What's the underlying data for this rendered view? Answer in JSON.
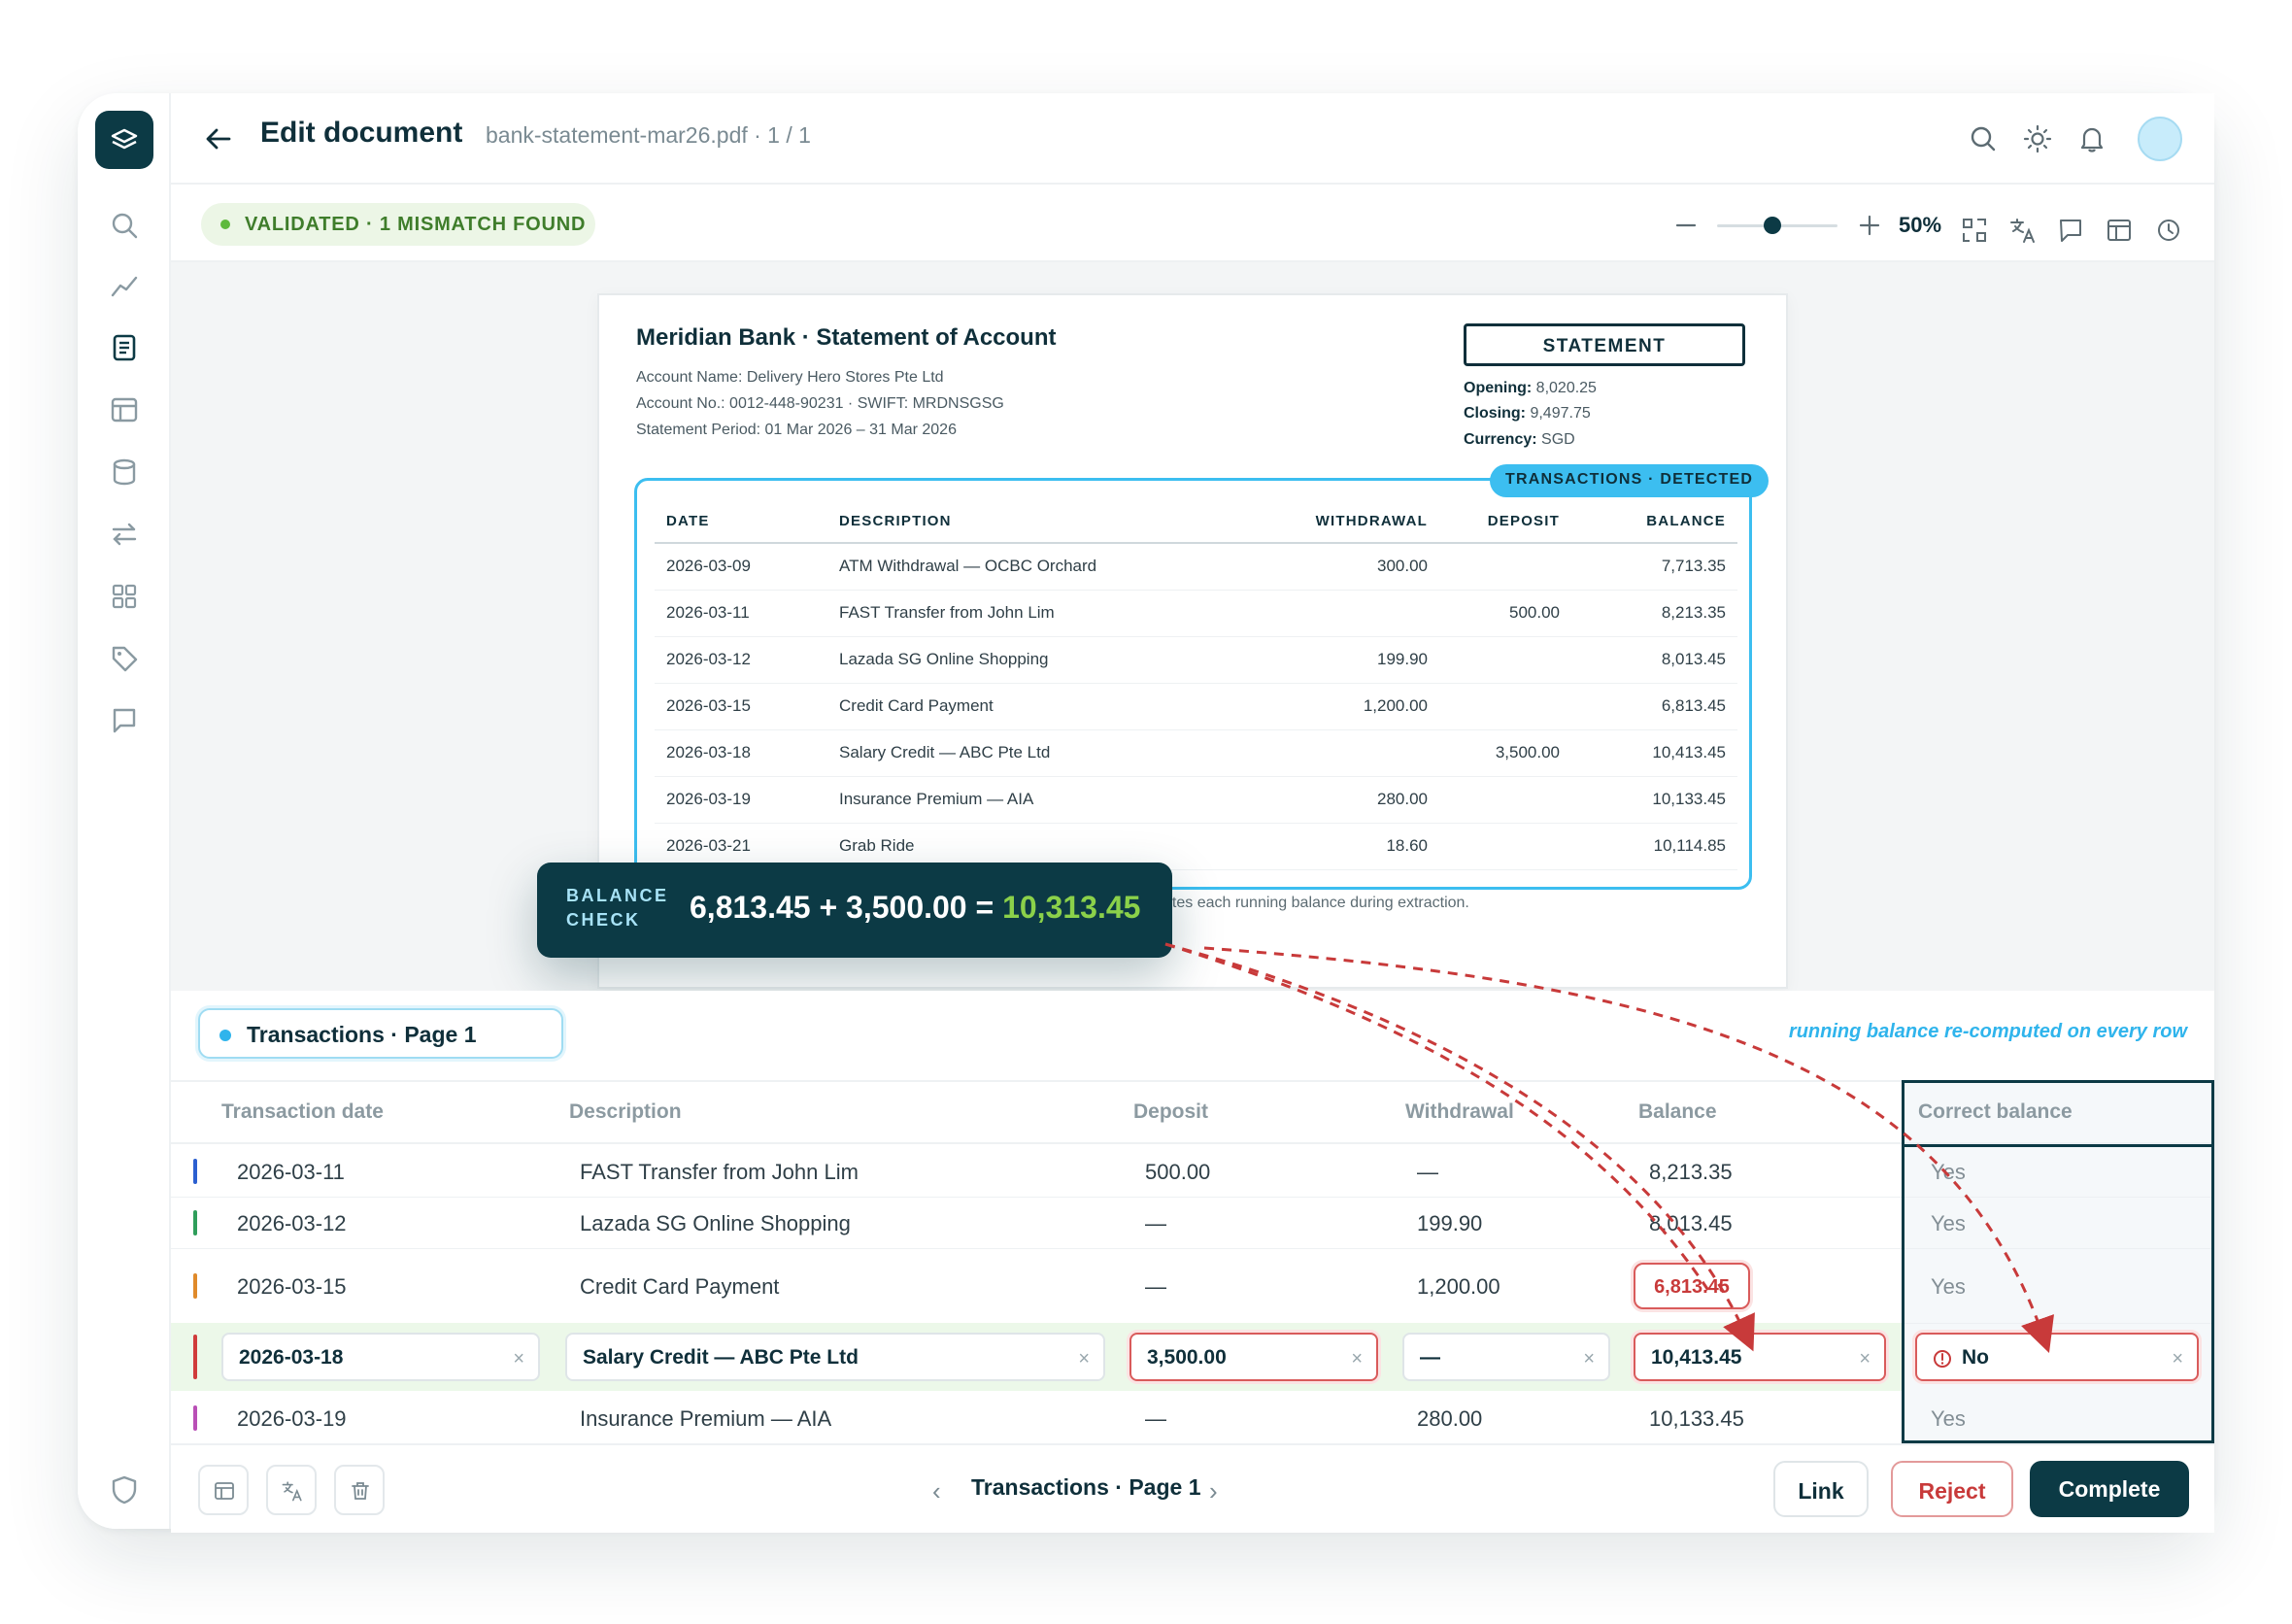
{
  "header": {
    "title": "Edit document",
    "file": "bank-statement-mar26.pdf · 1 / 1"
  },
  "status": {
    "badge": "VALIDATED · 1 MISMATCH FOUND",
    "zoom": "50%",
    "zoom_level": 0.5
  },
  "statement": {
    "title": "Meridian Bank · Statement of Account",
    "account_name": "Account Name: Delivery Hero Stores Pte Ltd",
    "account_no": "Account No.: 0012-448-90231  ·  SWIFT: MRDNSGSG",
    "period": "Statement Period: 01 Mar 2026 – 31 Mar 2026",
    "box_label": "STATEMENT",
    "opening_label": "Opening:",
    "opening": "8,020.25",
    "closing_label": "Closing:",
    "closing": "9,497.75",
    "currency_label": "Currency:",
    "currency": "SGD",
    "tag": "TRANSACTIONS · DETECTED",
    "columns": [
      "DATE",
      "DESCRIPTION",
      "WITHDRAWAL",
      "DEPOSIT",
      "BALANCE"
    ],
    "rows": [
      [
        "2026-03-09",
        "ATM Withdrawal — OCBC Orchard",
        "300.00",
        "",
        "7,713.35"
      ],
      [
        "2026-03-11",
        "FAST Transfer from John Lim",
        "",
        "500.00",
        "8,213.35"
      ],
      [
        "2026-03-12",
        "Lazada SG Online Shopping",
        "199.90",
        "",
        "8,013.45"
      ],
      [
        "2026-03-15",
        "Credit Card Payment",
        "1,200.00",
        "",
        "6,813.45"
      ],
      [
        "2026-03-18",
        "Salary Credit — ABC Pte Ltd",
        "",
        "3,500.00",
        "10,413.45"
      ],
      [
        "2026-03-19",
        "Insurance Premium — AIA",
        "280.00",
        "",
        "10,133.45"
      ],
      [
        "2026-03-21",
        "Grab Ride",
        "18.60",
        "",
        "10,114.85"
      ]
    ],
    "note": "utes each running balance during extraction."
  },
  "balance_check": {
    "label_1": "BALANCE",
    "label_2": "CHECK",
    "expression": "6,813.45 + 3,500.00 = ",
    "result": "10,313.45"
  },
  "panel": {
    "tab": "Transactions · Page 1",
    "note": "running balance re-computed on every row",
    "columns": [
      "Transaction date",
      "Description",
      "Deposit",
      "Withdrawal",
      "Balance",
      "Correct balance"
    ],
    "rows": [
      {
        "date": "2026-03-11",
        "desc": "FAST Transfer from John Lim",
        "deposit": "500.00",
        "withdrawal": "—",
        "balance": "8,213.35",
        "correct": "Yes",
        "color": "#2b5fd0"
      },
      {
        "date": "2026-03-12",
        "desc": "Lazada SG Online Shopping",
        "deposit": "—",
        "withdrawal": "199.90",
        "balance": "8,013.45",
        "correct": "Yes",
        "color": "#2f9e5b"
      },
      {
        "date": "2026-03-15",
        "desc": "Credit Card Payment",
        "deposit": "—",
        "withdrawal": "1,200.00",
        "balance": "6,813.45",
        "correct": "Yes",
        "color": "#e08a2a"
      },
      {
        "date": "2026-03-18",
        "desc": "Salary Credit — ABC Pte Ltd",
        "deposit": "3,500.00",
        "withdrawal": "—",
        "balance": "10,413.45",
        "correct": "No",
        "color": "#d03b3b"
      },
      {
        "date": "2026-03-19",
        "desc": "Insurance Premium — AIA",
        "deposit": "—",
        "withdrawal": "280.00",
        "balance": "10,133.45",
        "correct": "Yes",
        "color": "#b94fb6"
      }
    ],
    "clear_glyph": "×"
  },
  "footer": {
    "pager_label": "Transactions · Page 1",
    "prev": "‹",
    "next": "›",
    "link": "Link",
    "reject": "Reject",
    "complete": "Complete"
  },
  "colors": {
    "brand": "#0c3a45",
    "accent": "#2fb4ec",
    "valid": "#5eb93c",
    "error": "#d95b5b"
  }
}
